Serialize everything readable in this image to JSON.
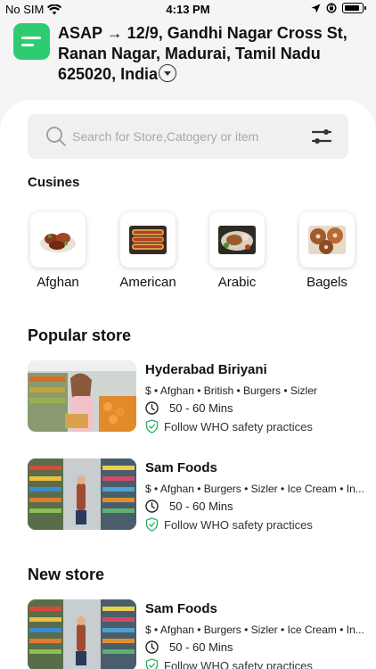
{
  "status_bar": {
    "carrier": "No SIM",
    "time": "4:13 PM"
  },
  "header": {
    "address": "ASAP → 12/9, Gandhi Nagar Cross St, Ranan Nagar, Madurai, Tamil Nadu 625020, India"
  },
  "search": {
    "placeholder": "Search for Store,Catogery or item"
  },
  "cuisines": {
    "title": "Cusines",
    "items": [
      {
        "label": "Afghan",
        "icon": "kebab-dish-icon"
      },
      {
        "label": "American",
        "icon": "hotdog-dish-icon"
      },
      {
        "label": "Arabic",
        "icon": "arabic-platter-icon"
      },
      {
        "label": "Bagels",
        "icon": "bagels-icon"
      }
    ]
  },
  "popular": {
    "title": "Popular store",
    "stores": [
      {
        "name": "Hyderabad Biriyani",
        "tags": "$ • Afghan • British • Burgers • Sizler",
        "time": "50 - 60 Mins",
        "safety": "Follow WHO safety practices"
      },
      {
        "name": "Sam Foods",
        "tags": "$ • Afghan • Burgers • Sizler • Ice Cream • In...",
        "time": "50 - 60 Mins",
        "safety": "Follow WHO safety practices"
      }
    ]
  },
  "new_stores": {
    "title": "New store",
    "stores": [
      {
        "name": "Sam Foods",
        "tags": "$ • Afghan • Burgers • Sizler • Ice Cream • In...",
        "time": "50 - 60 Mins",
        "safety": "Follow WHO safety practices"
      }
    ]
  },
  "colors": {
    "accent": "#2ecc71",
    "safety_green": "#27ae60"
  }
}
